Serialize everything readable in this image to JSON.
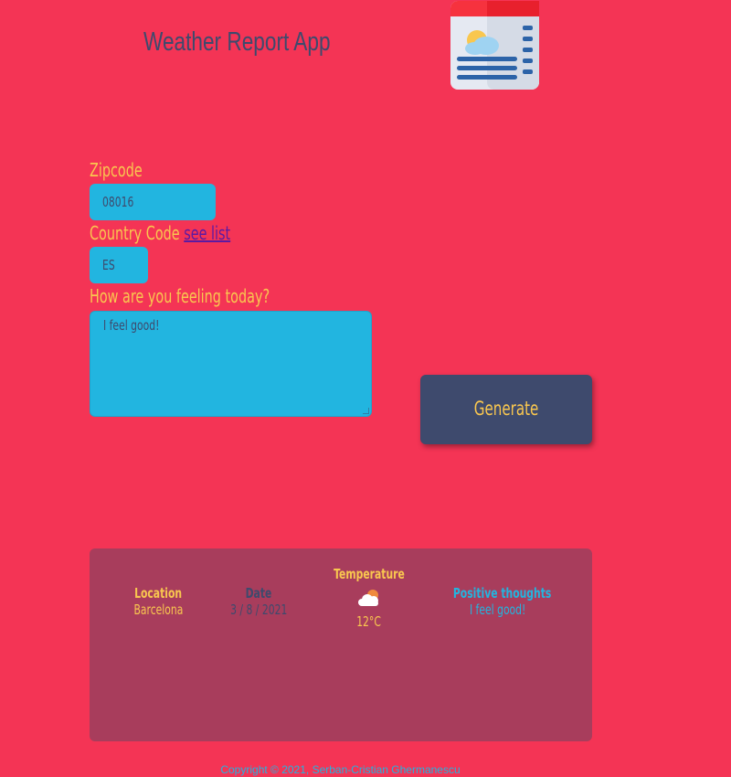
{
  "header": {
    "title": "Weather Report App",
    "logo_icon": "weather-news-icon"
  },
  "form": {
    "zip_label": "Zipcode",
    "zip_value": "08016",
    "country_label": "Country Code",
    "country_link": "see list",
    "country_value": "ES",
    "feelings_label": "How are you feeling today?",
    "feelings_value": "I feel good!",
    "generate_label": "Generate"
  },
  "results": {
    "location_heading": "Location",
    "location_value": "Barcelona",
    "date_heading": "Date",
    "date_value": "3 / 8 / 2021",
    "temperature_heading": "Temperature",
    "temperature_icon": "partly-cloudy-icon",
    "temperature_value": "12°C",
    "thoughts_heading": "Positive thoughts",
    "thoughts_value": "I feel good!"
  },
  "footer": {
    "copyright": "Copyright © 2021, Serban-Cristian Ghermanescu"
  },
  "colors": {
    "background": "#f43455",
    "accent_yellow": "#f9c74f",
    "accent_blue": "#22b5e0",
    "navy": "#3e4a6d",
    "panel": "#a83d5c"
  }
}
